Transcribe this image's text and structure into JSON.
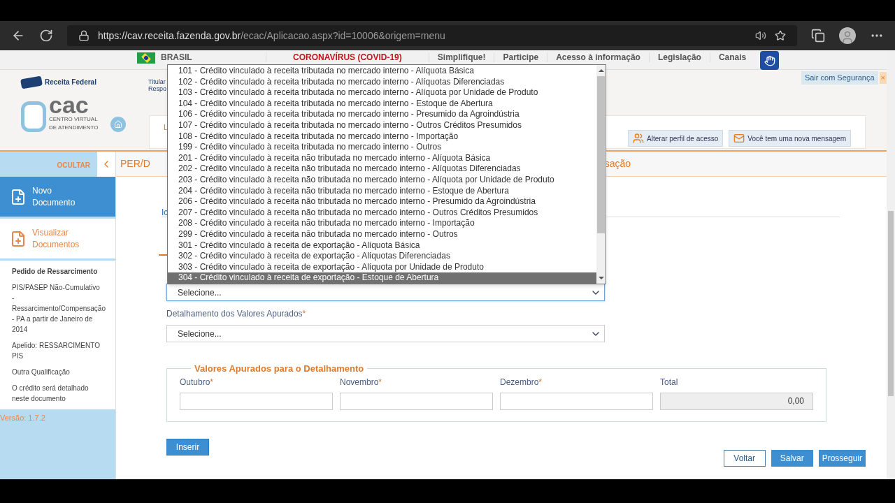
{
  "browser": {
    "url_host": "https://cav.receita.fazenda.gov.br",
    "url_path": "/ecac/Aplicacao.aspx?id=10006&origem=menu"
  },
  "gov_bar": {
    "country": "BRASIL",
    "links": [
      {
        "label": "CORONAVÍRUS (COVID-19)",
        "kind": "alert"
      },
      {
        "label": "Simplifique!",
        "kind": "normal"
      },
      {
        "label": "Participe",
        "kind": "normal"
      },
      {
        "label": "Acesso à informação",
        "kind": "normal"
      },
      {
        "label": "Legislação",
        "kind": "normal"
      },
      {
        "label": "Canais",
        "kind": "normal"
      }
    ]
  },
  "header": {
    "brand": "Receita Federal",
    "logo_text": "cac",
    "logo_sub": "CENTRO VIRTUAL",
    "logo_sub2": "DE ATENDIMENTO",
    "user_lines": [
      "Titular",
      "Respo"
    ],
    "field_label": "L",
    "logout": "Sair com Segurança",
    "logout_close": "×",
    "actions": [
      "Alterar perfil de acesso",
      "Você tem uma nova mensagem"
    ]
  },
  "sidebar": {
    "hide": "OCULTAR",
    "nav": [
      {
        "label": "Novo Documento",
        "selected": true
      },
      {
        "label": "Visualizar Documentos",
        "selected": false
      }
    ],
    "info": [
      "Pedido de Ressarcimento",
      "PIS/PASEP Não-Cumulativo - Ressarcimento/Compensação - PA a partir de Janeiro de 2014",
      "Apelido: RESSARCIMENTO PIS",
      "Outra Qualificação",
      "O crédito será detalhado neste documento"
    ],
    "version": "Versão: 1.7.2"
  },
  "main": {
    "title_left": "PER/D",
    "title_right": "sação",
    "tab_fragment": "Ic",
    "select_1": {
      "value": "Selecione..."
    },
    "detail_label": "Detalhamento dos Valores Apurados",
    "required_mark": "*",
    "select_2": {
      "value": "Selecione..."
    },
    "fieldset": {
      "legend": "Valores Apurados para o Detalhamento",
      "fields": [
        {
          "label": "Outubro",
          "required": true
        },
        {
          "label": "Novembro",
          "required": true
        },
        {
          "label": "Dezembro",
          "required": true
        },
        {
          "label": "Total",
          "required": false,
          "value": "0,00"
        }
      ]
    },
    "insert": "Inserir",
    "buttons": [
      {
        "label": "Voltar",
        "kind": "outline"
      },
      {
        "label": "Salvar",
        "kind": "primary"
      },
      {
        "label": "Prosseguir",
        "kind": "primary"
      }
    ]
  },
  "dropdown": {
    "options": [
      {
        "label": "101 - Crédito vinculado à receita tributada no mercado interno - Alíquota Básica",
        "selected": false
      },
      {
        "label": "102 - Crédito vinculado à receita tributada no mercado interno - Alíquotas Diferenciadas",
        "selected": false
      },
      {
        "label": "103 - Crédito vinculado à receita tributada no mercado interno - Alíquota por Unidade de Produto",
        "selected": false
      },
      {
        "label": "104 - Crédito vinculado à receita tributada no mercado interno - Estoque de Abertura",
        "selected": false
      },
      {
        "label": "106 - Crédito vinculado à receita tributada no mercado interno - Presumido da Agroindústria",
        "selected": false
      },
      {
        "label": "107 - Crédito vinculado à receita tributada no mercado interno - Outros Créditos Presumidos",
        "selected": false
      },
      {
        "label": "108 - Crédito vinculado à receita tributada no mercado interno - Importação",
        "selected": false
      },
      {
        "label": "199 - Crédito vinculado à receita tributada no mercado interno - Outros",
        "selected": false
      },
      {
        "label": "201 - Crédito vinculado à receita não tributada no mercado interno - Alíquota Básica",
        "selected": false
      },
      {
        "label": "202 - Crédito vinculado à receita não tributada no mercado interno - Alíquotas Diferenciadas",
        "selected": false
      },
      {
        "label": "203 - Crédito vinculado à receita não tributada no mercado interno - Alíquota por Unidade de Produto",
        "selected": false
      },
      {
        "label": "204 - Crédito vinculado à receita não tributada no mercado interno - Estoque de Abertura",
        "selected": false
      },
      {
        "label": "206 - Crédito vinculado à receita não tributada no mercado interno - Presumido da Agroindústria",
        "selected": false
      },
      {
        "label": "207 - Crédito vinculado à receita não tributada no mercado interno - Outros Créditos Presumidos",
        "selected": false
      },
      {
        "label": "208 - Crédito vinculado à receita não tributada no mercado interno - Importação",
        "selected": false
      },
      {
        "label": "299 - Crédito vinculado à receita não tributada no mercado interno - Outros",
        "selected": false
      },
      {
        "label": "301 - Crédito vinculado à receita de exportação - Alíquota Básica",
        "selected": false
      },
      {
        "label": "302 - Crédito vinculado à receita de exportação - Alíquotas Diferenciadas",
        "selected": false
      },
      {
        "label": "303 - Crédito vinculado à receita de exportação - Alíquota por Unidade de Produto",
        "selected": false
      },
      {
        "label": "304 - Crédito vinculado à receita de exportação - Estoque de Abertura",
        "selected": true
      }
    ]
  }
}
